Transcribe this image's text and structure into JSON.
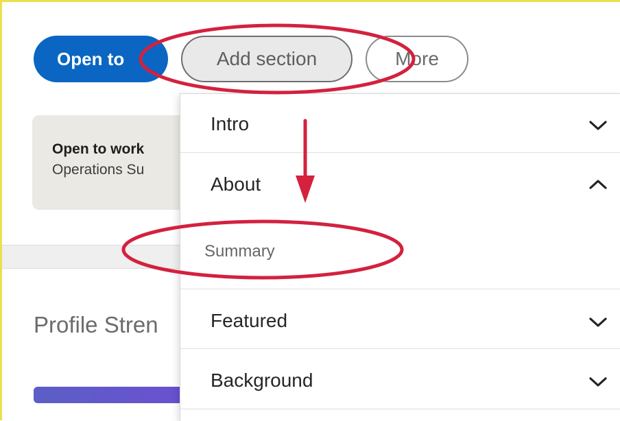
{
  "actions": {
    "open_to": "Open to",
    "add_section": "Add section",
    "more": "More"
  },
  "open_to_work": {
    "title": "Open to work",
    "subtitle": "Operations Su"
  },
  "profile_strength": {
    "label": "Profile Stren"
  },
  "menu": {
    "items": [
      {
        "label": "Intro",
        "chevron": "chevron-down-icon"
      },
      {
        "label": "About",
        "chevron": "chevron-up-icon"
      },
      {
        "label": "Featured",
        "chevron": "chevron-down-icon"
      },
      {
        "label": "Background",
        "chevron": "chevron-down-icon"
      }
    ],
    "about_subitems": [
      "Summary"
    ]
  },
  "annotation": {
    "color": "#d3213e"
  }
}
